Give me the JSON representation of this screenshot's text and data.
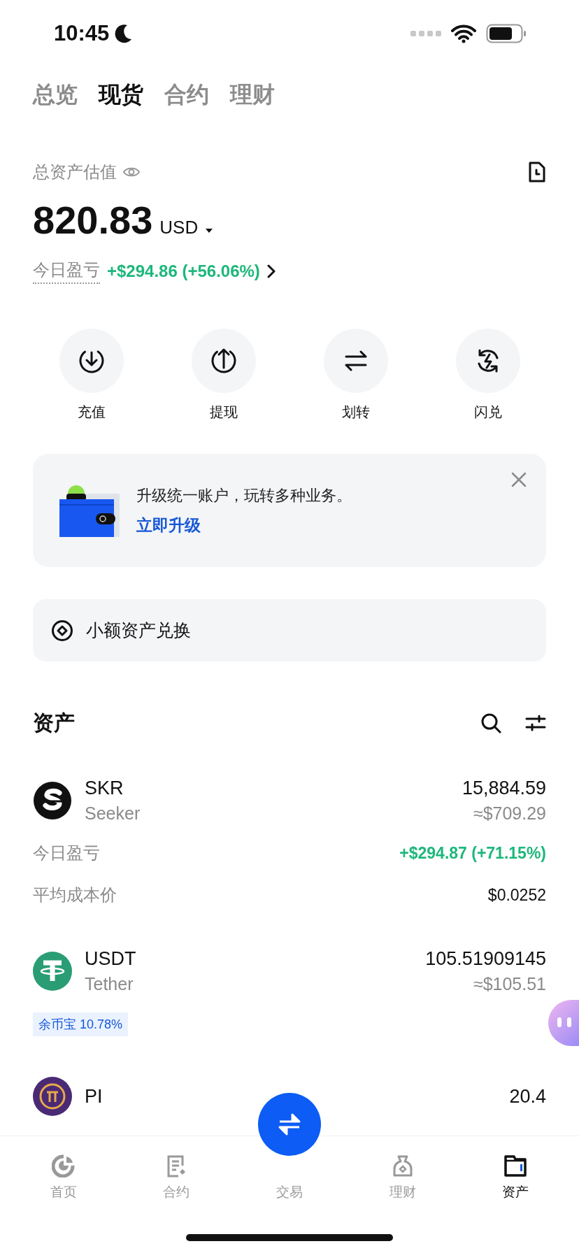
{
  "status_bar": {
    "time": "10:45"
  },
  "top_tabs": [
    {
      "label": "总览",
      "selected": false
    },
    {
      "label": "现货",
      "selected": true
    },
    {
      "label": "合约",
      "selected": false
    },
    {
      "label": "理财",
      "selected": false
    }
  ],
  "total": {
    "label": "总资产估值",
    "amount": "820.83",
    "currency": "USD",
    "pnl_label": "今日盈亏",
    "pnl_value": "+$294.86 (+56.06%)"
  },
  "actions": [
    {
      "label": "充值",
      "kind": "deposit"
    },
    {
      "label": "提现",
      "kind": "withdraw"
    },
    {
      "label": "划转",
      "kind": "transfer"
    },
    {
      "label": "闪兑",
      "kind": "convert"
    }
  ],
  "banner": {
    "text": "升级统一账户，玩转多种业务。",
    "link": "立即升级"
  },
  "small_convert": {
    "label": "小额资产兑换"
  },
  "assets": {
    "title": "资产",
    "items": [
      {
        "kind": "skr",
        "symbol": "SKR",
        "name": "Seeker",
        "amount": "15,884.59",
        "value": "≈$709.29",
        "details": [
          {
            "label": "今日盈亏",
            "value": "+$294.87 (+71.15%)",
            "positive": true
          },
          {
            "label": "平均成本价",
            "value": "$0.0252",
            "positive": false
          }
        ]
      },
      {
        "kind": "usdt",
        "symbol": "USDT",
        "name": "Tether",
        "amount": "105.51909145",
        "value": "≈$105.51",
        "tag": "余币宝 10.78%"
      },
      {
        "kind": "pi",
        "symbol": "PI",
        "amount": "20.4"
      }
    ]
  },
  "bottom_nav": [
    {
      "kind": "home",
      "label": "首页",
      "selected": false
    },
    {
      "kind": "contract",
      "label": "合约",
      "selected": false
    },
    {
      "kind": "trade",
      "label": "交易",
      "selected": false
    },
    {
      "kind": "earn",
      "label": "理财",
      "selected": false
    },
    {
      "kind": "assets",
      "label": "资产",
      "selected": true
    }
  ]
}
